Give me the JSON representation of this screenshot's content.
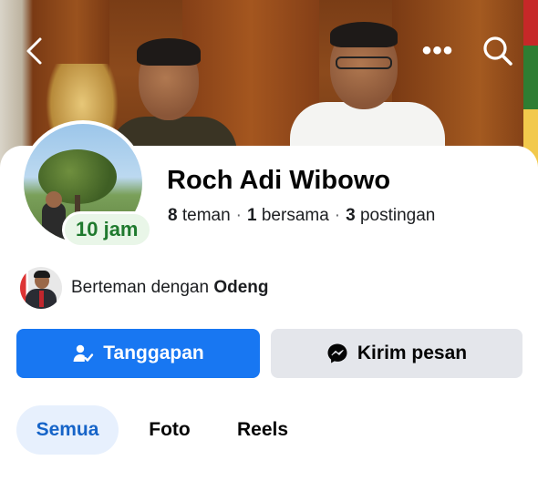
{
  "cover": {
    "back_icon": "chevron-left-icon",
    "more_icon": "more-horizontal-icon",
    "more_glyph": "•••",
    "search_icon": "search-icon"
  },
  "profile": {
    "name": "Roch Adi Wibowo",
    "story_time": "10 jam",
    "stats": {
      "friends_count": "8",
      "friends_label": "teman",
      "mutual_count": "1",
      "mutual_label": "bersama",
      "posts_count": "3",
      "posts_label": "postingan"
    },
    "mutual": {
      "prefix": "Berteman dengan",
      "friend_name": "Odeng"
    }
  },
  "actions": {
    "primary_label": "Tanggapan",
    "primary_icon": "friend-check-icon",
    "secondary_label": "Kirim pesan",
    "secondary_icon": "messenger-icon"
  },
  "tabs": [
    {
      "label": "Semua",
      "active": true
    },
    {
      "label": "Foto",
      "active": false
    },
    {
      "label": "Reels",
      "active": false
    }
  ],
  "colors": {
    "primary": "#1877f2",
    "secondary_bg": "#e4e6eb",
    "active_tab_bg": "#e7f0fd",
    "active_tab_text": "#1664c8",
    "story_badge_bg": "#e9f6e8",
    "story_badge_text": "#1f7a2e"
  }
}
